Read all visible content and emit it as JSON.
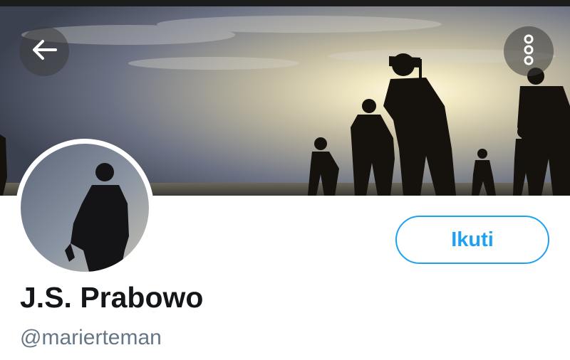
{
  "status_bar": {
    "color": "#1c1c1c"
  },
  "banner": {
    "description": "silhouettes of soldiers against sunset sky"
  },
  "header": {
    "back_icon": "arrow-left-icon",
    "more_icon": "vertical-dots-icon"
  },
  "profile": {
    "display_name": "J.S. Prabowo",
    "handle": "@marierteman",
    "follow_label": "Ikuti"
  },
  "colors": {
    "accent": "#1da1f2",
    "name_text": "#14171a",
    "handle_text": "#657786"
  }
}
